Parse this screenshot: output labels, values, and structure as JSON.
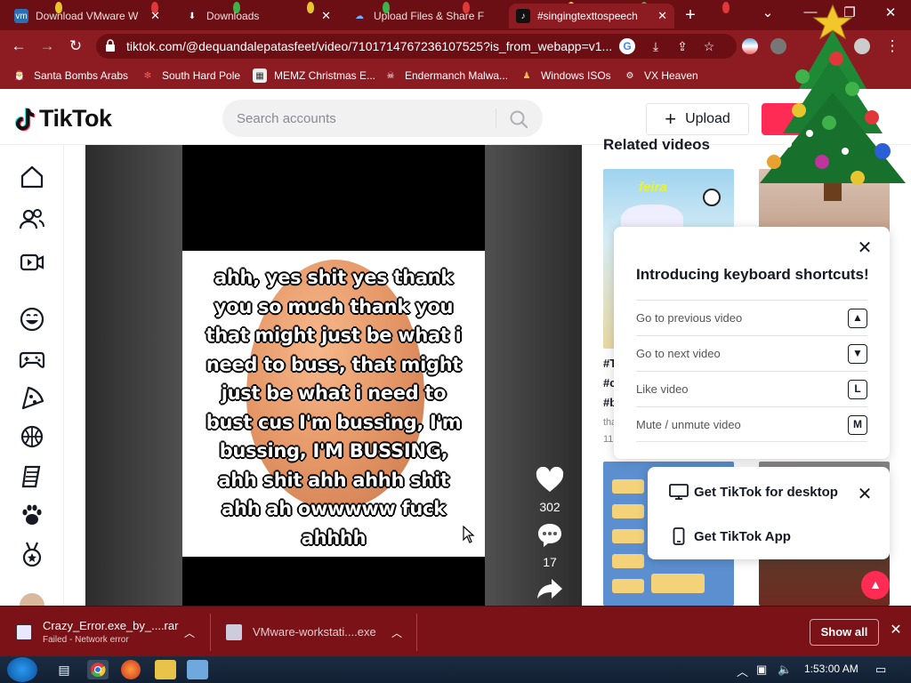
{
  "browser": {
    "tabs": [
      {
        "label": "Download VMware W",
        "icon": "vmware-icon",
        "active": false
      },
      {
        "label": "Downloads",
        "icon": "download-icon",
        "active": false
      },
      {
        "label": "Upload Files & Share F",
        "icon": "cloud-icon",
        "active": false
      },
      {
        "label": "#singingtexttospeech",
        "icon": "tiktok-icon",
        "active": true
      }
    ],
    "new_tab": "+",
    "url": "tiktok.com/@dequandalepatasfeet/video/7101714767236107525?is_from_webapp=v1...",
    "bookmarks": [
      {
        "label": "Santa Bombs Arabs",
        "icon": "santa-icon"
      },
      {
        "label": "South Hard Pole",
        "icon": "snowflake-icon"
      },
      {
        "label": "MEMZ Christmas E...",
        "icon": "memz-icon"
      },
      {
        "label": "Endermanch Malwa...",
        "icon": "skull-icon"
      },
      {
        "label": "Windows ISOs",
        "icon": "chess-icon"
      },
      {
        "label": "VX Heaven",
        "icon": "gear-icon"
      }
    ]
  },
  "tiktok": {
    "logo": "TikTok",
    "search_placeholder": "Search accounts",
    "upload_label": "Upload",
    "video": {
      "caption": "ahh, yes shit yes thank you so much thank you that might just be what i need to buss, that might just be what i need to bust cus I'm bussing, I'm bussing, I'M BUSSING, ahh shit ahh ahhh shit ahh ah owwwww fuck ahhhh",
      "likes": "302",
      "comments": "17"
    },
    "related_title": "Related videos",
    "related": [
      {
        "meta_lines": [
          "#T",
          "#c",
          "#b"
        ],
        "sub": "tha",
        "sub2": "11"
      }
    ],
    "keyboard_popup": {
      "title": "Introducing keyboard shortcuts!",
      "rows": [
        {
          "label": "Go to previous video",
          "key": "▲"
        },
        {
          "label": "Go to next video",
          "key": "▼"
        },
        {
          "label": "Like video",
          "key": "L"
        },
        {
          "label": "Mute / unmute video",
          "key": "M"
        }
      ]
    },
    "get_popup": {
      "desktop": "Get TikTok for desktop",
      "app": "Get TikTok App"
    }
  },
  "downloads": [
    {
      "name": "Crazy_Error.exe_by_....rar",
      "status": "Failed - Network error"
    },
    {
      "name": "VMware-workstati....exe",
      "status": ""
    }
  ],
  "show_all": "Show all",
  "taskbar": {
    "clock": "1:53:00 AM"
  },
  "colors": {
    "browser_bg": "#8c1c22",
    "tiktok_red": "#fe2c55"
  }
}
